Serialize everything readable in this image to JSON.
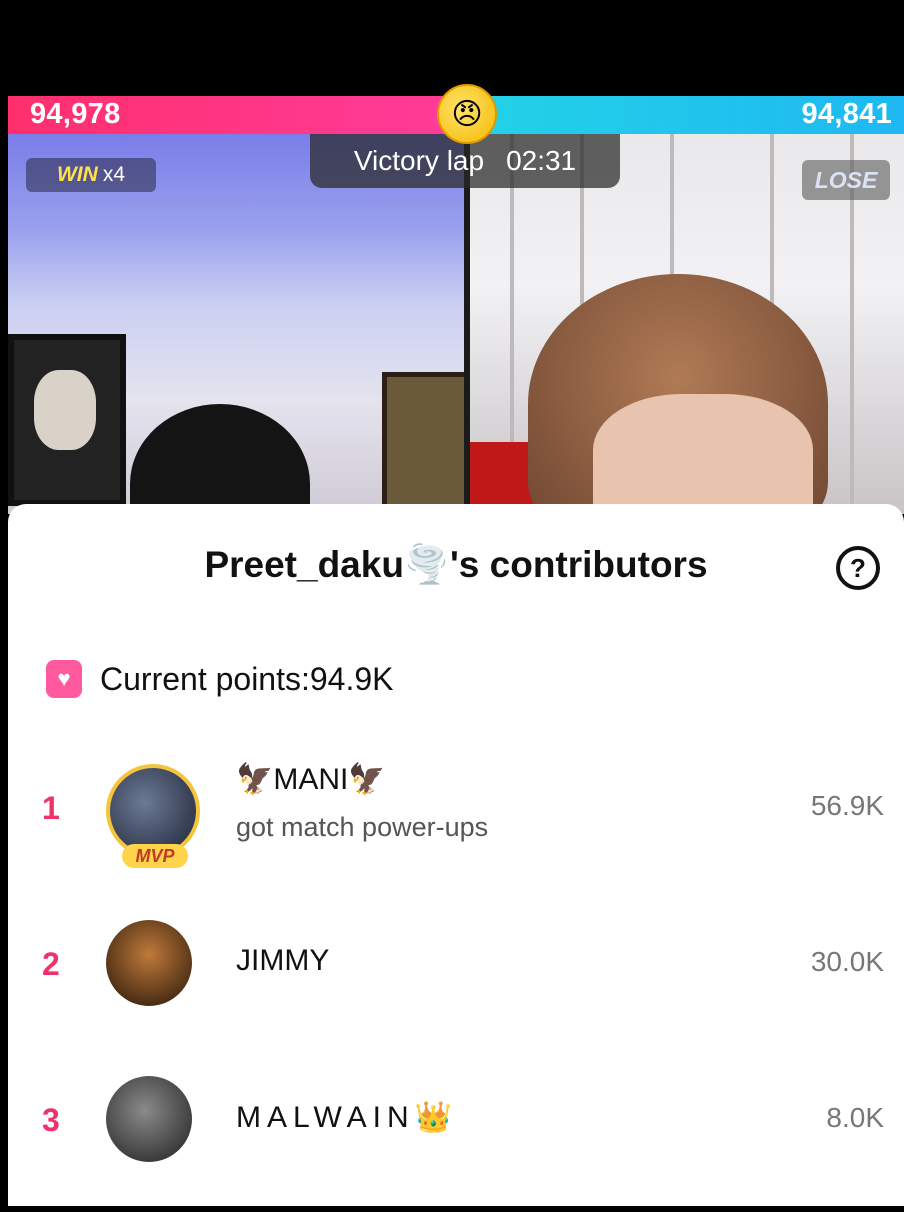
{
  "battle": {
    "left_score": "94,978",
    "right_score": "94,841",
    "center_emoji": "😠",
    "left_fill_percent": 50.03,
    "win_badge_word": "WIN",
    "win_badge_mult": "x4",
    "lose_badge": "LOSE",
    "victory_label": "Victory lap",
    "timer": "02:31"
  },
  "sheet": {
    "title": "Preet_daku🌪️'s contributors",
    "help_icon": "question-circle-icon",
    "points_icon": "gift-icon",
    "current_points": "Current points:94.9K"
  },
  "contributors": [
    {
      "rank": "1",
      "name": "🦅MANI🦅",
      "subtitle": "got match power-ups",
      "badge": "MVP",
      "points": "56.9K"
    },
    {
      "rank": "2",
      "name": "JIMMY",
      "points": "30.0K"
    },
    {
      "rank": "3",
      "name": "MALWAIN👑",
      "points": "8.0K"
    }
  ],
  "colors": {
    "left_team": "#ff2f6c",
    "right_team": "#22d3e6",
    "rank": "#f0326a"
  }
}
